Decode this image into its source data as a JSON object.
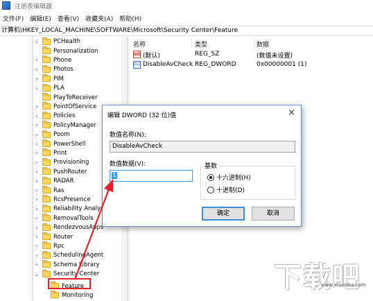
{
  "window": {
    "title": "注册表编辑器"
  },
  "menu": [
    "文件(F)",
    "编辑(E)",
    "查看(V)",
    "收藏夹(A)",
    "帮助(H)"
  ],
  "address": "计算机\\HKEY_LOCAL_MACHINE\\SOFTWARE\\Microsoft\\Security Center\\Feature",
  "tree": {
    "items": [
      {
        "label": "PCHealth",
        "chev": ">"
      },
      {
        "label": "Personalization",
        "chev": ""
      },
      {
        "label": "Phone",
        "chev": ">"
      },
      {
        "label": "Photos",
        "chev": ">"
      },
      {
        "label": "PIM",
        "chev": ">"
      },
      {
        "label": "PLA",
        "chev": ">"
      },
      {
        "label": "PlayToReceiver",
        "chev": ""
      },
      {
        "label": "PointOfService",
        "chev": ">"
      },
      {
        "label": "Policies",
        "chev": ">"
      },
      {
        "label": "PolicyManager",
        "chev": ">"
      },
      {
        "label": "Poom",
        "chev": ">"
      },
      {
        "label": "PowerShell",
        "chev": ">"
      },
      {
        "label": "Print",
        "chev": ">"
      },
      {
        "label": "Provisioning",
        "chev": ">"
      },
      {
        "label": "PushRouter",
        "chev": ">"
      },
      {
        "label": "RADAR",
        "chev": ">"
      },
      {
        "label": "Ras",
        "chev": ">"
      },
      {
        "label": "RcsPresence",
        "chev": ">"
      },
      {
        "label": "Reliability Analysis",
        "chev": ">"
      },
      {
        "label": "RemovalTools",
        "chev": ">"
      },
      {
        "label": "RendezvousApps",
        "chev": ">"
      },
      {
        "label": "Router",
        "chev": ">"
      },
      {
        "label": "Rpc",
        "chev": ">"
      },
      {
        "label": "SchedulingAgent",
        "chev": ">"
      },
      {
        "label": "Schema Library",
        "chev": ">"
      },
      {
        "label": "Security Center",
        "chev": "v"
      }
    ],
    "children": [
      {
        "label": "Feature",
        "selected": true
      },
      {
        "label": "Monitoring"
      }
    ]
  },
  "list": {
    "headers": [
      "名称",
      "类型",
      "数据"
    ],
    "rows": [
      {
        "icon": "ab",
        "name": "(默认)",
        "type": "REG_SZ",
        "data": "(数值未设置)"
      },
      {
        "icon": "bin",
        "name": "DisableAvCheck",
        "type": "REG_DWORD",
        "data": "0x00000001 (1)"
      }
    ]
  },
  "dialog": {
    "title": "编辑 DWORD (32 位)值",
    "close": "×",
    "name_label": "数值名称(N):",
    "name_value": "DisableAvCheck",
    "data_label": "数值数据(V):",
    "data_value": "1",
    "base_label": "基数",
    "radio_hex": "十六进制(H)",
    "radio_dec": "十进制(D)",
    "hex_selected": true,
    "ok": "确定",
    "cancel": "取消"
  },
  "icons": {
    "ab": "ab",
    "bin": "011",
    "chev_right": "›",
    "chev_down": "⌄"
  },
  "watermark": {
    "logo_text": "下载吧",
    "sub": "www.xiazaiba.com"
  },
  "colors": {
    "highlight": "#e8202a",
    "folder": "#ffd65c",
    "accent": "#3399ff"
  }
}
